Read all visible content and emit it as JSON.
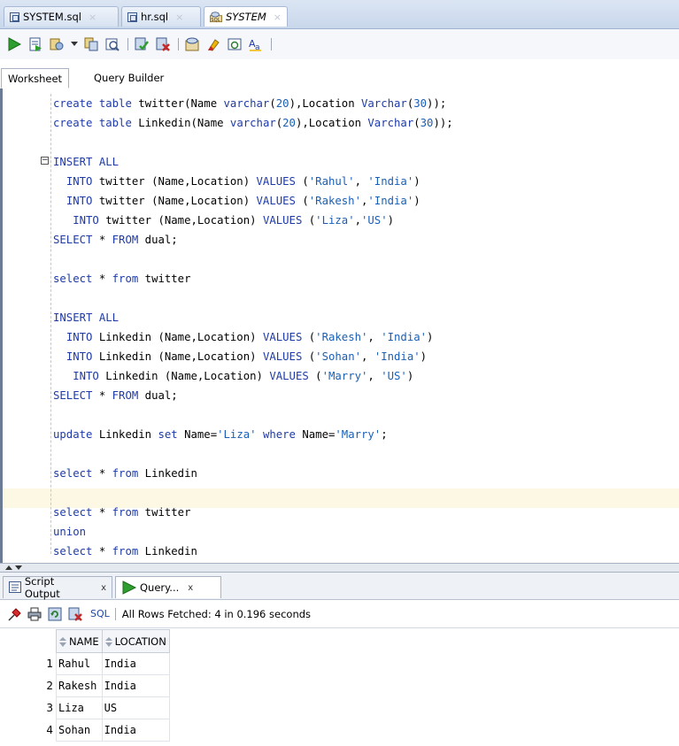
{
  "file_tabs": [
    {
      "label": "SYSTEM.sql",
      "active": false
    },
    {
      "label": "hr.sql",
      "active": false
    },
    {
      "label": "SYSTEM",
      "active": true
    }
  ],
  "worksheet_tabs": [
    {
      "label": "Worksheet"
    },
    {
      "label": "Query Builder"
    }
  ],
  "editor": {
    "lines": [
      "create table twitter(Name varchar(20),Location Varchar(30));",
      "create table Linkedin(Name varchar(20),Location Varchar(30));",
      "",
      "INSERT ALL",
      "  INTO twitter (Name,Location) VALUES ('Rahul', 'India')",
      "  INTO twitter (Name,Location) VALUES ('Rakesh','India')",
      "   INTO twitter (Name,Location) VALUES ('Liza','US')",
      "SELECT * FROM dual;",
      "",
      "select * from twitter",
      "",
      "INSERT ALL",
      "  INTO Linkedin (Name,Location) VALUES ('Rakesh', 'India')",
      "  INTO Linkedin (Name,Location) VALUES ('Sohan', 'India')",
      "   INTO Linkedin (Name,Location) VALUES ('Marry', 'US')",
      "SELECT * FROM dual;",
      "",
      "update Linkedin set Name='Liza' where Name='Marry';",
      "",
      "select * from Linkedin",
      "",
      "select * from twitter",
      "union",
      "select * from Linkedin"
    ]
  },
  "output_tabs": [
    {
      "label": "Script Output",
      "close": "x"
    },
    {
      "label": "Query...",
      "close": "x"
    }
  ],
  "results_toolbar": {
    "sql_label": "SQL",
    "status": "All Rows Fetched: 4 in 0.196 seconds"
  },
  "results": {
    "columns": [
      "NAME",
      "LOCATION"
    ],
    "rows": [
      {
        "num": "1",
        "name": "Rahul",
        "location": "India"
      },
      {
        "num": "2",
        "name": "Rakesh",
        "location": "India"
      },
      {
        "num": "3",
        "name": "Liza",
        "location": "US"
      },
      {
        "num": "4",
        "name": "Sohan",
        "location": "India"
      }
    ]
  },
  "colors": {
    "keyword": "#1e3aa8",
    "string": "#1a5fb4",
    "current_line": "#fdf8e4"
  }
}
